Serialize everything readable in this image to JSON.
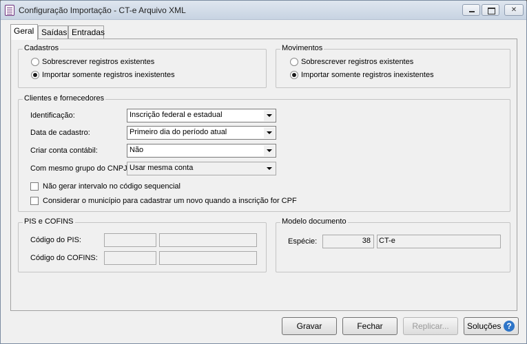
{
  "window": {
    "title": "Configuração Importação - CT-e Arquivo XML",
    "min_icon": "minimize-icon",
    "max_icon": "maximize-icon",
    "close_glyph": "✕"
  },
  "tabs": [
    {
      "label": "Geral",
      "active": true
    },
    {
      "label": "Saídas",
      "active": false
    },
    {
      "label": "Entradas",
      "active": false
    }
  ],
  "cadastros": {
    "title": "Cadastros",
    "options": [
      {
        "label": "Sobrescrever registros existentes",
        "checked": false
      },
      {
        "label": "Importar somente registros inexistentes",
        "checked": true
      }
    ]
  },
  "movimentos": {
    "title": "Movimentos",
    "options": [
      {
        "label": "Sobrescrever registros existentes",
        "checked": false
      },
      {
        "label": "Importar somente registros inexistentes",
        "checked": true
      }
    ]
  },
  "clientes": {
    "title": "Clientes e fornecedores",
    "fields": [
      {
        "label": "Identificação:",
        "value": "Inscrição federal e estadual",
        "disabled": false
      },
      {
        "label": "Data de cadastro:",
        "value": "Primeiro dia do período atual",
        "disabled": false
      },
      {
        "label": "Criar conta contábil:",
        "value": "Não",
        "disabled": false
      },
      {
        "label": "Com mesmo grupo do CNPJ:",
        "value": "Usar mesma conta",
        "disabled": true
      }
    ],
    "checks": [
      {
        "label": "Não gerar intervalo no código sequencial",
        "checked": false
      },
      {
        "label": "Considerar o município para cadastrar um novo quando a inscrição for CPF",
        "checked": false
      }
    ]
  },
  "pis_cofins": {
    "title": "PIS e COFINS",
    "pis_label": "Código do PIS:",
    "cofins_label": "Código do COFINS:",
    "pis_code": "",
    "pis_desc": "",
    "cofins_code": "",
    "cofins_desc": ""
  },
  "modelo": {
    "title": "Modelo documento",
    "especie_label": "Espécie:",
    "especie_code": "38",
    "especie_desc": "CT-e"
  },
  "footer": {
    "gravar": "Gravar",
    "fechar": "Fechar",
    "replicar": "Replicar...",
    "solucoes": "Soluções",
    "help_glyph": "?"
  },
  "colors": {
    "help_icon": "#2e75c8",
    "title_gradient_top": "#dfe6ef",
    "title_gradient_bottom": "#c7d3e2"
  }
}
